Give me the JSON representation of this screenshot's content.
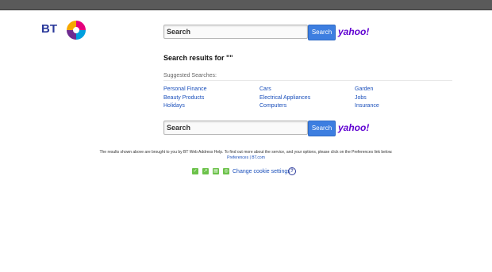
{
  "brand": {
    "logo_text": "BT"
  },
  "search": {
    "placeholder": "Search",
    "button_label": "Search",
    "partner_logo": "yahoo!"
  },
  "results": {
    "title": "Search results for \"\""
  },
  "suggested": {
    "heading": "Suggested Searches:",
    "columns": [
      [
        "Personal Finance",
        "Beauty Products",
        "Holidays"
      ],
      [
        "Cars",
        "Electrical Appliances",
        "Computers"
      ],
      [
        "Garden",
        "Jobs",
        "Insurance"
      ]
    ]
  },
  "footer": {
    "notice": "The results shown above are brought to you by BT Web Address Help. To find out more about the service, and your options, please click on the Preferences link below.",
    "preferences_link": "Preferences",
    "separator": "|",
    "btcom_link": "BT.com"
  },
  "cookie": {
    "icons": [
      "cookie-strictly-necessary-icon",
      "cookie-performance-icon",
      "cookie-functional-icon",
      "cookie-targeting-icon"
    ],
    "link_label": "Change cookie settings",
    "help_icon": "help-icon"
  },
  "colors": {
    "bt_blue": "#2b3a9b",
    "button_blue": "#3d7ee0",
    "yahoo_purple": "#5f01d1",
    "link_blue": "#1a4fbb",
    "cookie_green": "#6cc24a"
  }
}
